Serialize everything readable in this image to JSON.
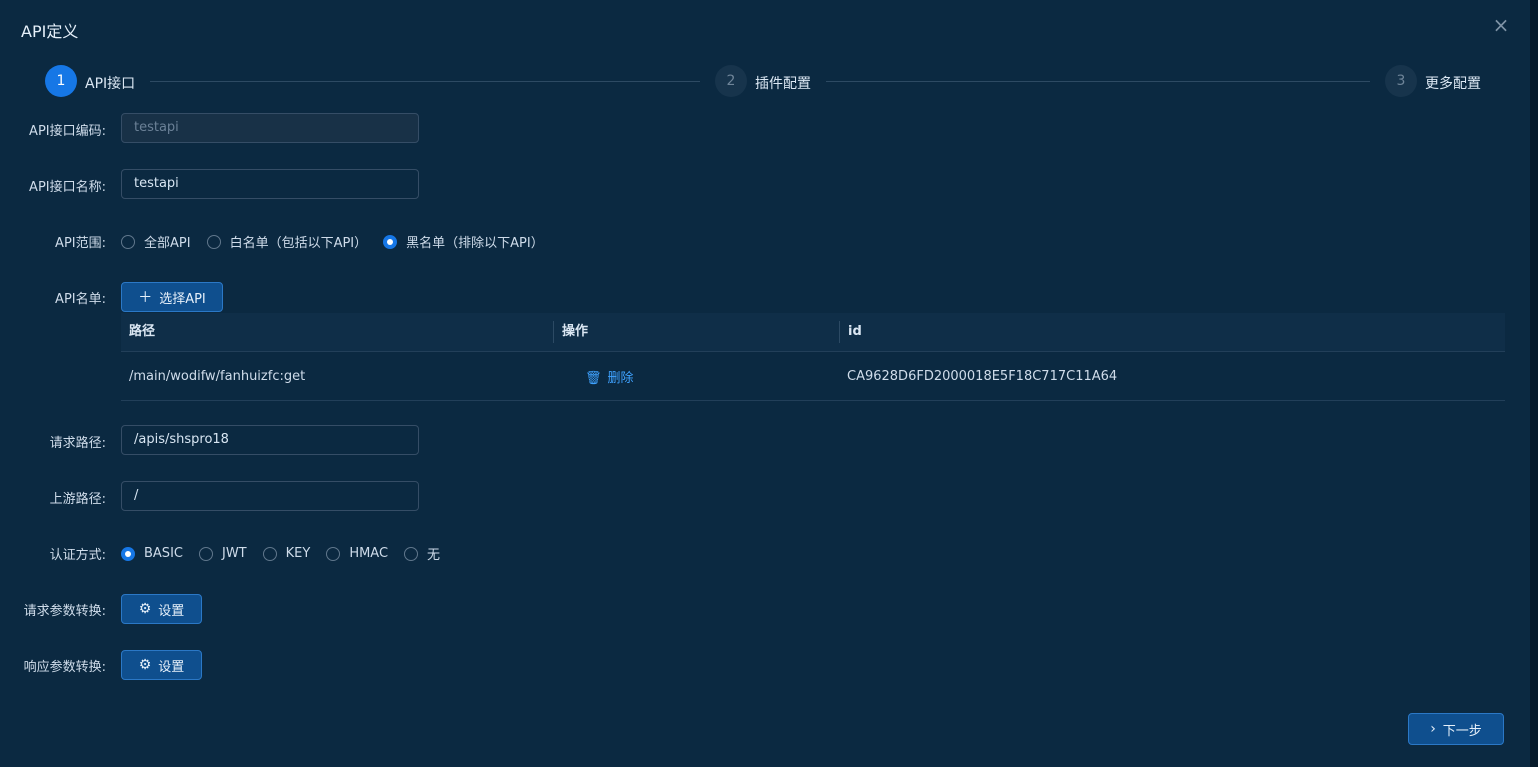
{
  "dialog": {
    "title": "API定义",
    "close_icon": "×"
  },
  "steps": [
    {
      "number": "1",
      "label": "API接口",
      "active": true
    },
    {
      "number": "2",
      "label": "插件配置",
      "active": false
    },
    {
      "number": "3",
      "label": "更多配置",
      "active": false
    }
  ],
  "form": {
    "code": {
      "label": "API接口编码:",
      "value": "testapi"
    },
    "name": {
      "label": "API接口名称:",
      "value": "testapi"
    },
    "scope": {
      "label": "API范围:",
      "options": [
        "全部API",
        "白名单（包括以下API）",
        "黑名单（排除以下API）"
      ],
      "selected": "黑名单（排除以下API）"
    },
    "api_list": {
      "label": "API名单:",
      "select_button": "选择API",
      "columns": [
        "路径",
        "操作",
        "id"
      ],
      "rows": [
        {
          "path": "/main/wodifw/fanhuizfc:get",
          "action": "删除",
          "id": "CA9628D6FD2000018E5F18C717C11A64"
        }
      ]
    },
    "request_path": {
      "label": "请求路径:",
      "value": "/apis/shspro18"
    },
    "upstream_path": {
      "label": "上游路径:",
      "value": "/"
    },
    "auth": {
      "label": "认证方式:",
      "options": [
        "BASIC",
        "JWT",
        "KEY",
        "HMAC",
        "无"
      ],
      "selected": "BASIC"
    },
    "request_transform": {
      "label": "请求参数转换:",
      "button": "设置"
    },
    "response_transform": {
      "label": "响应参数转换:",
      "button": "设置"
    }
  },
  "footer": {
    "next_button": "下一步"
  },
  "colors": {
    "background": "#0b2941",
    "accent": "#1677e6",
    "link": "#3fa2ff"
  }
}
